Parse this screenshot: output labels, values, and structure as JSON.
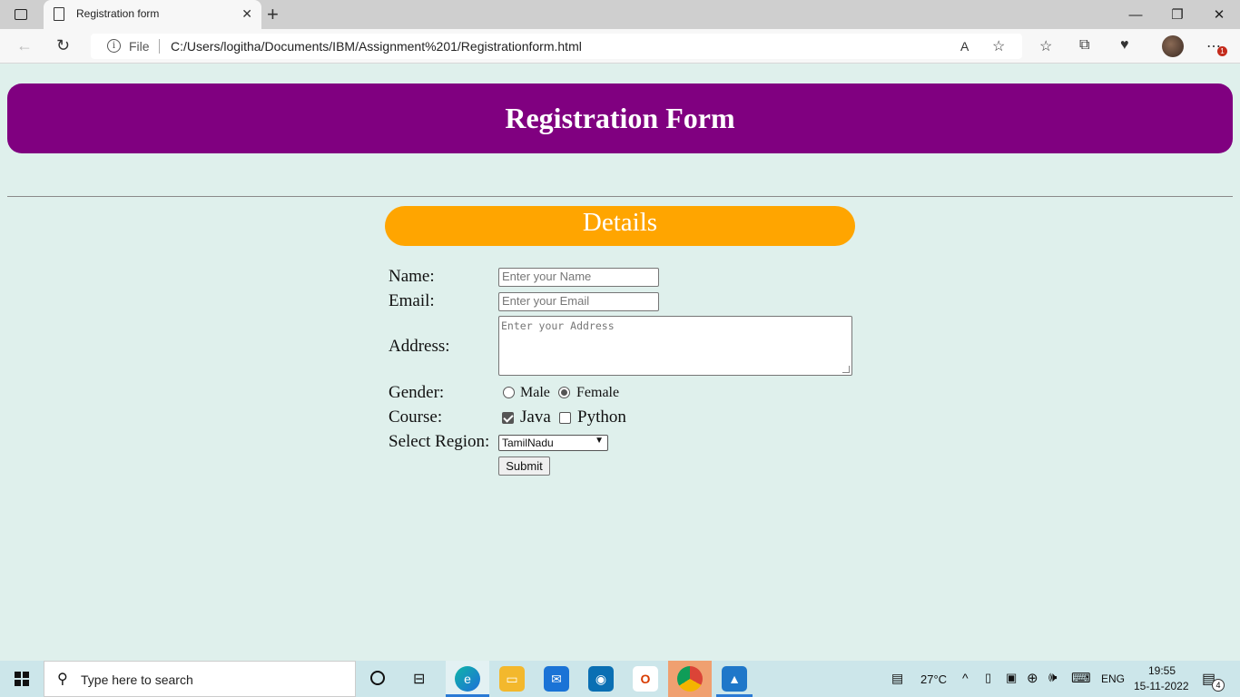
{
  "browser": {
    "tab_title": "Registration form",
    "new_tab": "+",
    "url_scheme_label": "File",
    "url": "C:/Users/logitha/Documents/IBM/Assignment%201/Registrationform.html",
    "notification_count": "1",
    "window_controls": {
      "minimize": "—",
      "restore": "❐",
      "close": "✕"
    }
  },
  "page": {
    "header_title": "Registration Form",
    "section_title": "Details",
    "form": {
      "name_label": "Name:",
      "name_placeholder": "Enter your Name",
      "email_label": "Email:",
      "email_placeholder": "Enter your Email",
      "address_label": "Address:",
      "address_placeholder": "Enter your Address",
      "gender_label": "Gender:",
      "gender_options": [
        {
          "label": "Male",
          "checked": false
        },
        {
          "label": "Female",
          "checked": true
        }
      ],
      "course_label": "Course:",
      "course_options": [
        {
          "label": "Java",
          "checked": true
        },
        {
          "label": "Python",
          "checked": false
        }
      ],
      "region_label": "Select Region:",
      "region_selected": "TamilNadu",
      "submit_label": "Submit"
    },
    "colors": {
      "header_bg": "#800080",
      "details_bg": "#ffa500",
      "page_bg": "#dff0ec"
    }
  },
  "taskbar": {
    "search_placeholder": "Type here to search",
    "weather": "27°C",
    "language": "ENG",
    "time": "19:55",
    "date": "15-11-2022",
    "notifications": "4"
  }
}
